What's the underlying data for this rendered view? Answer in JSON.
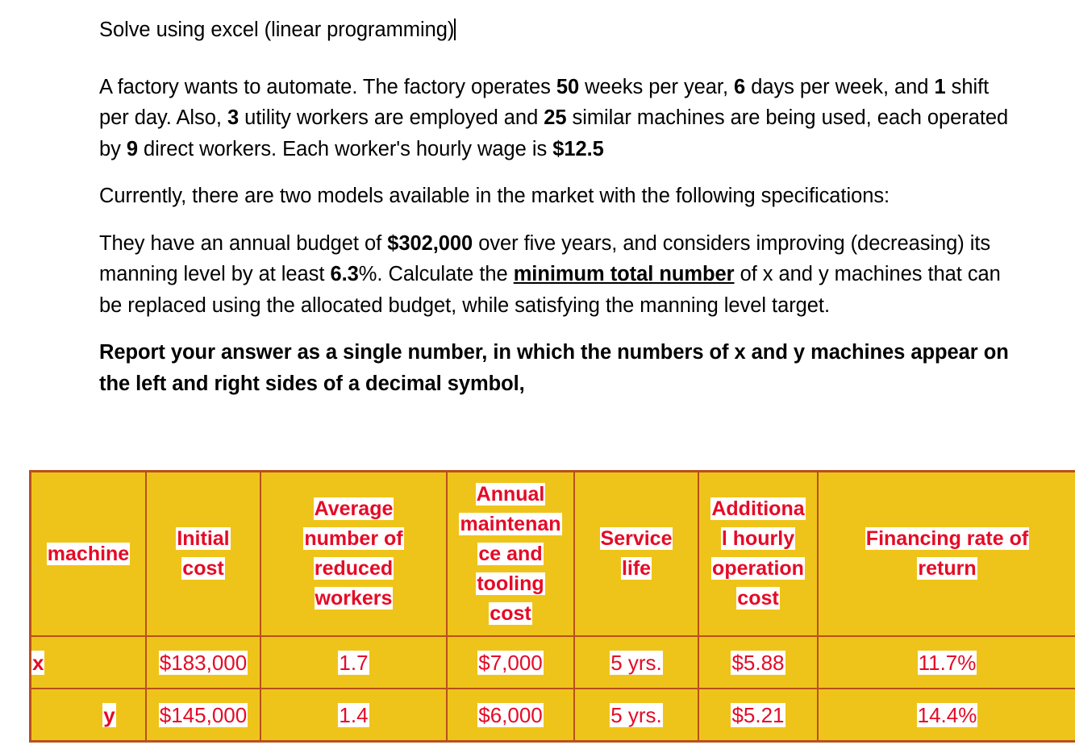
{
  "document": {
    "prompt_line": "Solve using excel (linear programming)",
    "paragraphs": [
      {
        "id": "p-factory",
        "runs": [
          {
            "text": "A factory wants to automate. The factory operates ",
            "style": "normal"
          },
          {
            "text": "50",
            "style": "bold"
          },
          {
            "text": " weeks per year, ",
            "style": "normal"
          },
          {
            "text": "6",
            "style": "bold"
          },
          {
            "text": " days per week, and ",
            "style": "normal"
          },
          {
            "text": "1",
            "style": "bold"
          },
          {
            "text": " shift per day. Also, ",
            "style": "normal"
          },
          {
            "text": "3",
            "style": "bold"
          },
          {
            "text": " utility workers are employed and ",
            "style": "normal"
          },
          {
            "text": "25",
            "style": "bold"
          },
          {
            "text": " similar machines are being used, each operated by ",
            "style": "normal"
          },
          {
            "text": "9",
            "style": "bold"
          },
          {
            "text": " direct workers. Each worker's hourly wage is ",
            "style": "normal"
          },
          {
            "text": "$12.5",
            "style": "bold"
          }
        ]
      },
      {
        "id": "p-models",
        "runs": [
          {
            "text": "Currently, there are two models available in the market with the following specifications:",
            "style": "normal"
          }
        ]
      },
      {
        "id": "p-budget",
        "runs": [
          {
            "text": "They have an annual budget of ",
            "style": "normal"
          },
          {
            "text": "$302,000",
            "style": "bold"
          },
          {
            "text": " over five years, and considers improving (decreasing) its manning level by at least ",
            "style": "normal"
          },
          {
            "text": "6.3",
            "style": "bold"
          },
          {
            "text": "%. Calculate the ",
            "style": "normal"
          },
          {
            "text": "minimum total number",
            "style": "bold-underline"
          },
          {
            "text": " of x and y machines that can be replaced using the allocated budget, while satisfying the manning level target.",
            "style": "normal"
          }
        ]
      },
      {
        "id": "p-instruction",
        "runs": [
          {
            "text": "Report your answer as a single number, in which the numbers of x and y machines appear on the left and right sides of a decimal symbol,",
            "style": "bold"
          }
        ]
      }
    ]
  },
  "spec_table": {
    "headers": [
      "machine",
      "Initial cost",
      "Average number of reduced workers",
      "Annual maintenance and tooling cost",
      "Service life",
      "Additional hourly operation cost",
      "Financing rate of return"
    ],
    "header_lines": [
      [
        "machine"
      ],
      [
        "Initial",
        "cost"
      ],
      [
        "Average",
        "number of",
        "reduced",
        "workers"
      ],
      [
        "Annual",
        "maintenan",
        "ce and",
        "tooling",
        "cost"
      ],
      [
        "Service",
        "life"
      ],
      [
        "Additiona",
        "l hourly",
        "operation",
        "cost"
      ],
      [
        "Financing rate of",
        "return"
      ]
    ],
    "rows": [
      {
        "machine": "x",
        "initial_cost": "$183,000",
        "avg_reduced_workers": "1.7",
        "annual_maintenance_tooling_cost": "$7,000",
        "service_life": "5 yrs.",
        "additional_hourly_operation_cost": "$5.88",
        "financing_rate_of_return": "11.7%"
      },
      {
        "machine": "y",
        "initial_cost": "$145,000",
        "avg_reduced_workers": "1.4",
        "annual_maintenance_tooling_cost": "$6,000",
        "service_life": "5 yrs.",
        "additional_hourly_operation_cost": "$5.21",
        "financing_rate_of_return": "14.4%"
      }
    ]
  },
  "colors": {
    "table_background": "#EFC41A",
    "table_border": "#B8501D",
    "highlight_text": "#E50B26",
    "highlight_background": "#FFFFFF",
    "body_text": "#000000"
  }
}
